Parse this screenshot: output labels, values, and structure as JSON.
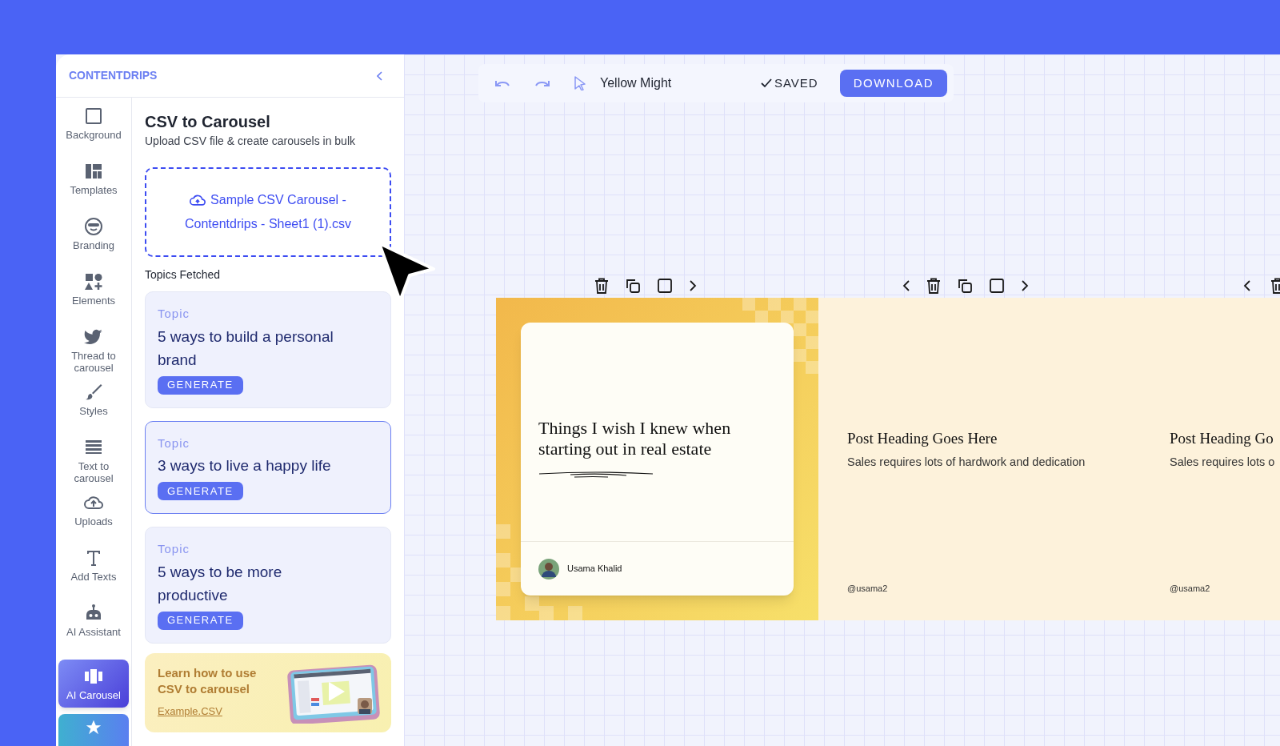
{
  "brand": "CONTENTDRIPS",
  "sidebar": {
    "items": [
      {
        "label": "Background",
        "selected": false
      },
      {
        "label": "Templates",
        "selected": false
      },
      {
        "label": "Branding",
        "selected": false
      },
      {
        "label": "Elements",
        "selected": false
      },
      {
        "label": "Thread to carousel",
        "selected": false
      },
      {
        "label": "Styles",
        "selected": false
      },
      {
        "label": "Text to carousel",
        "selected": false
      },
      {
        "label": "Uploads",
        "selected": false
      },
      {
        "label": "Add Texts",
        "selected": false
      },
      {
        "label": "AI Assistant",
        "selected": false
      },
      {
        "label": "AI Carousel",
        "selected": true
      }
    ]
  },
  "panel": {
    "title": "CSV to Carousel",
    "subtitle": "Upload CSV file & create carousels in bulk",
    "upload_file": "Sample CSV Carousel - Contentdrips - Sheet1 (1).csv",
    "topics_label": "Topics Fetched",
    "topics": [
      {
        "label": "Topic",
        "title": "5 ways to build a personal brand",
        "button": "GENERATE",
        "selected": false
      },
      {
        "label": "Topic",
        "title": "3 ways to live a happy life",
        "button": "GENERATE",
        "selected": true
      },
      {
        "label": "Topic",
        "title": "5 ways to be more productive",
        "button": "GENERATE",
        "selected": false
      }
    ],
    "promo": {
      "title": "Learn how to use CSV to carousel",
      "link": "Example.CSV"
    }
  },
  "toolbar": {
    "document_name": "Yellow Might",
    "status": "SAVED",
    "download": "DOWNLOAD"
  },
  "slides": [
    {
      "kind": "quote",
      "heading": "Things I wish I knew when starting out in real estate",
      "author": "Usama Khalid"
    },
    {
      "kind": "post",
      "heading": "Post Heading Goes Here",
      "body": "Sales requires lots of hardwork and dedication",
      "handle": "@usama2"
    },
    {
      "kind": "post",
      "heading": "Post Heading Go",
      "body": "Sales requires lots o",
      "handle": "@usama2"
    }
  ]
}
